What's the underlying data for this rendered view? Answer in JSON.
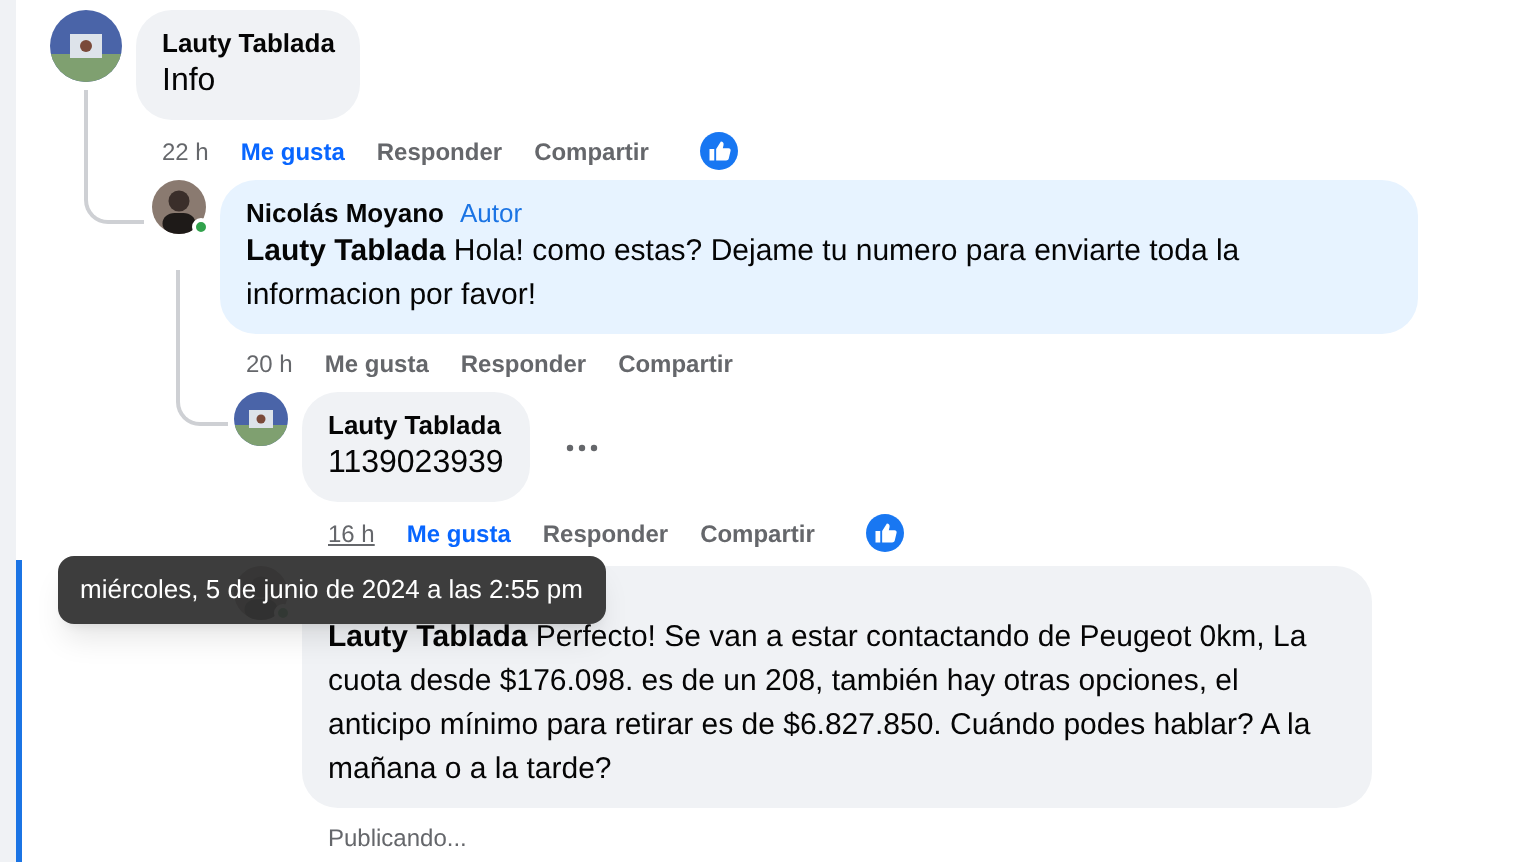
{
  "comments": [
    {
      "author": "Lauty Tablada",
      "text": "Info",
      "time": "22 h",
      "time_hovered": false,
      "actions": [
        "Me gusta",
        "Responder",
        "Compartir"
      ],
      "liked": true,
      "reaction": true,
      "children": [
        {
          "author": "Nicolás Moyano",
          "badge": "Autor",
          "online": true,
          "mention": "Lauty Tablada",
          "text": "Hola! como estas? Dejame tu numero para enviarte toda la informacion por favor!",
          "time": "20 h",
          "time_hovered": false,
          "actions": [
            "Me gusta",
            "Responder",
            "Compartir"
          ],
          "liked": false,
          "children": [
            {
              "author": "Lauty Tablada",
              "text": "1139023939",
              "time": "16 h",
              "time_hovered": true,
              "more_button": true,
              "actions": [
                "Me gusta",
                "Responder",
                "Compartir"
              ],
              "liked": true,
              "reaction": true
            },
            {
              "online": true,
              "highlighted": true,
              "mention": "Lauty Tablada",
              "text": "Perfecto! Se van a estar contactando de Peugeot 0km, La cuota desde $176.098. es de un 208, también hay otras opciones, el anticipo mínimo para retirar es de $6.827.850. Cuándo podes hablar? A la mañana o a la tarde?",
              "status": "Publicando..."
            }
          ]
        }
      ]
    }
  ],
  "tooltip": "miércoles, 5 de junio de 2024 a las 2:55 pm"
}
